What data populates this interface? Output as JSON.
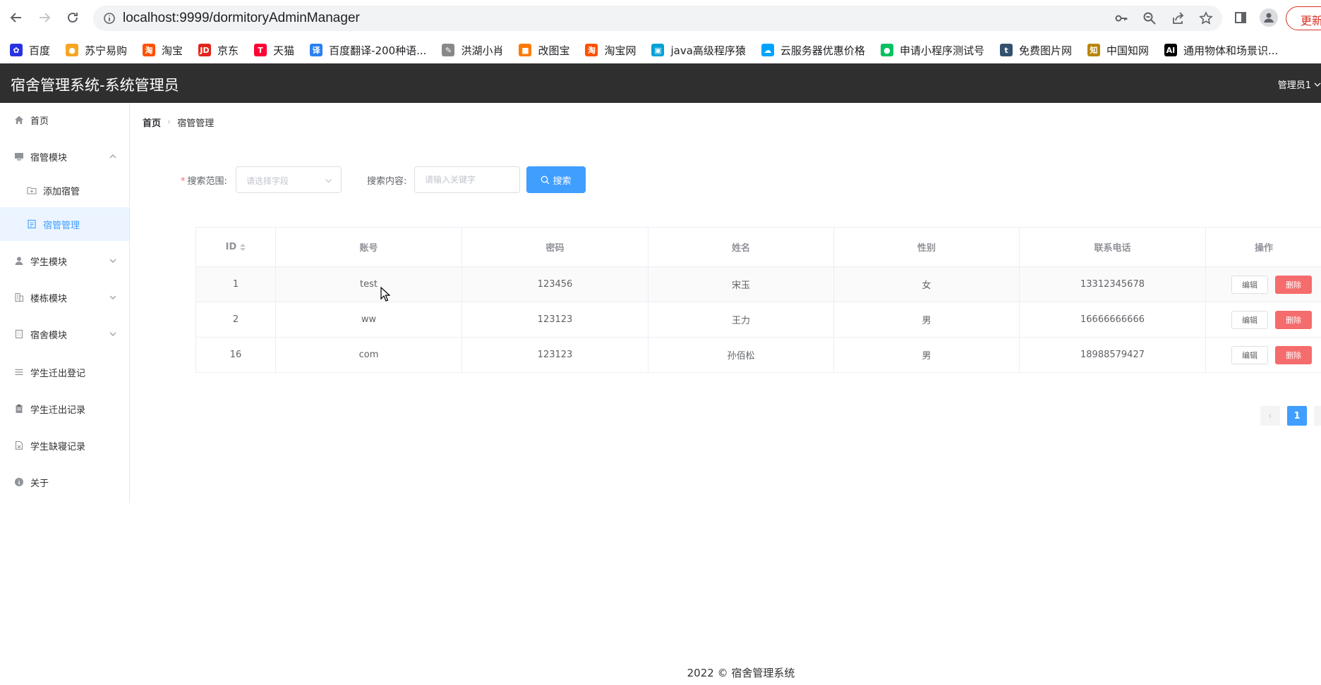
{
  "browser": {
    "url": "localhost:9999/dormitoryAdminManager",
    "update_label": "更新",
    "bookmarks": [
      {
        "label": "百度",
        "color": "#2932e1",
        "glyph": "✿"
      },
      {
        "label": "苏宁易购",
        "color": "#f5a623",
        "glyph": "●"
      },
      {
        "label": "淘宝",
        "color": "#ff5000",
        "glyph": "淘"
      },
      {
        "label": "京东",
        "color": "#e1251b",
        "glyph": "JD"
      },
      {
        "label": "天猫",
        "color": "#ff0036",
        "glyph": "T"
      },
      {
        "label": "百度翻译-200种语...",
        "color": "#2a7ff3",
        "glyph": "译"
      },
      {
        "label": "洪湖小肖",
        "color": "#888888",
        "glyph": "✎"
      },
      {
        "label": "改图宝",
        "color": "#ff7a00",
        "glyph": "■"
      },
      {
        "label": "淘宝网",
        "color": "#ff5000",
        "glyph": "淘"
      },
      {
        "label": "java高级程序猿",
        "color": "#00a1d6",
        "glyph": "▣"
      },
      {
        "label": "云服务器优惠价格",
        "color": "#00a3ff",
        "glyph": "☁"
      },
      {
        "label": "申请小程序测试号",
        "color": "#07c160",
        "glyph": "●"
      },
      {
        "label": "免费图片网",
        "color": "#34526f",
        "glyph": "t"
      },
      {
        "label": "中国知网",
        "color": "#b8860b",
        "glyph": "知"
      },
      {
        "label": "通用物体和场景识...",
        "color": "#000000",
        "glyph": "AI"
      }
    ]
  },
  "header": {
    "title": "宿舍管理系统-系统管理员",
    "user": "管理员1"
  },
  "sidebar": {
    "items": [
      {
        "label": "首页",
        "icon": "home-icon"
      },
      {
        "label": "宿管模块",
        "icon": "monitor-icon"
      },
      {
        "label": "添加宿管",
        "icon": "folder-add-icon"
      },
      {
        "label": "宿管管理",
        "icon": "document-icon"
      },
      {
        "label": "学生模块",
        "icon": "user-icon"
      },
      {
        "label": "楼栋模块",
        "icon": "building-icon"
      },
      {
        "label": "宿舍模块",
        "icon": "office-icon"
      },
      {
        "label": "学生迁出登记",
        "icon": "list-icon"
      },
      {
        "label": "学生迁出记录",
        "icon": "clipboard-icon"
      },
      {
        "label": "学生缺寝记录",
        "icon": "document-x-icon"
      },
      {
        "label": "关于",
        "icon": "info-icon"
      }
    ]
  },
  "breadcrumb": {
    "home": "首页",
    "current": "宿管管理"
  },
  "search": {
    "scope_label": "搜索范围:",
    "scope_placeholder": "请选择字段",
    "content_label": "搜索内容:",
    "content_placeholder": "请输入关键字",
    "button_label": "搜索"
  },
  "table": {
    "headers": [
      "ID",
      "账号",
      "密码",
      "姓名",
      "性别",
      "联系电话",
      "操作"
    ],
    "rows": [
      {
        "id": "1",
        "account": "test",
        "password": "123456",
        "name": "宋玉",
        "gender": "女",
        "phone": "13312345678"
      },
      {
        "id": "2",
        "account": "ww",
        "password": "123123",
        "name": "王力",
        "gender": "男",
        "phone": "16666666666"
      },
      {
        "id": "16",
        "account": "com",
        "password": "123123",
        "name": "孙佰松",
        "gender": "男",
        "phone": "18988579427"
      }
    ],
    "edit_label": "编辑",
    "delete_label": "删除"
  },
  "pagination": {
    "prev": "‹",
    "current_page": "1",
    "next": "›"
  },
  "footer": {
    "text": "2022 © 宿舍管理系统"
  },
  "colors": {
    "primary": "#409eff",
    "danger": "#f56c6c",
    "header_bg": "#2f2f2f"
  }
}
